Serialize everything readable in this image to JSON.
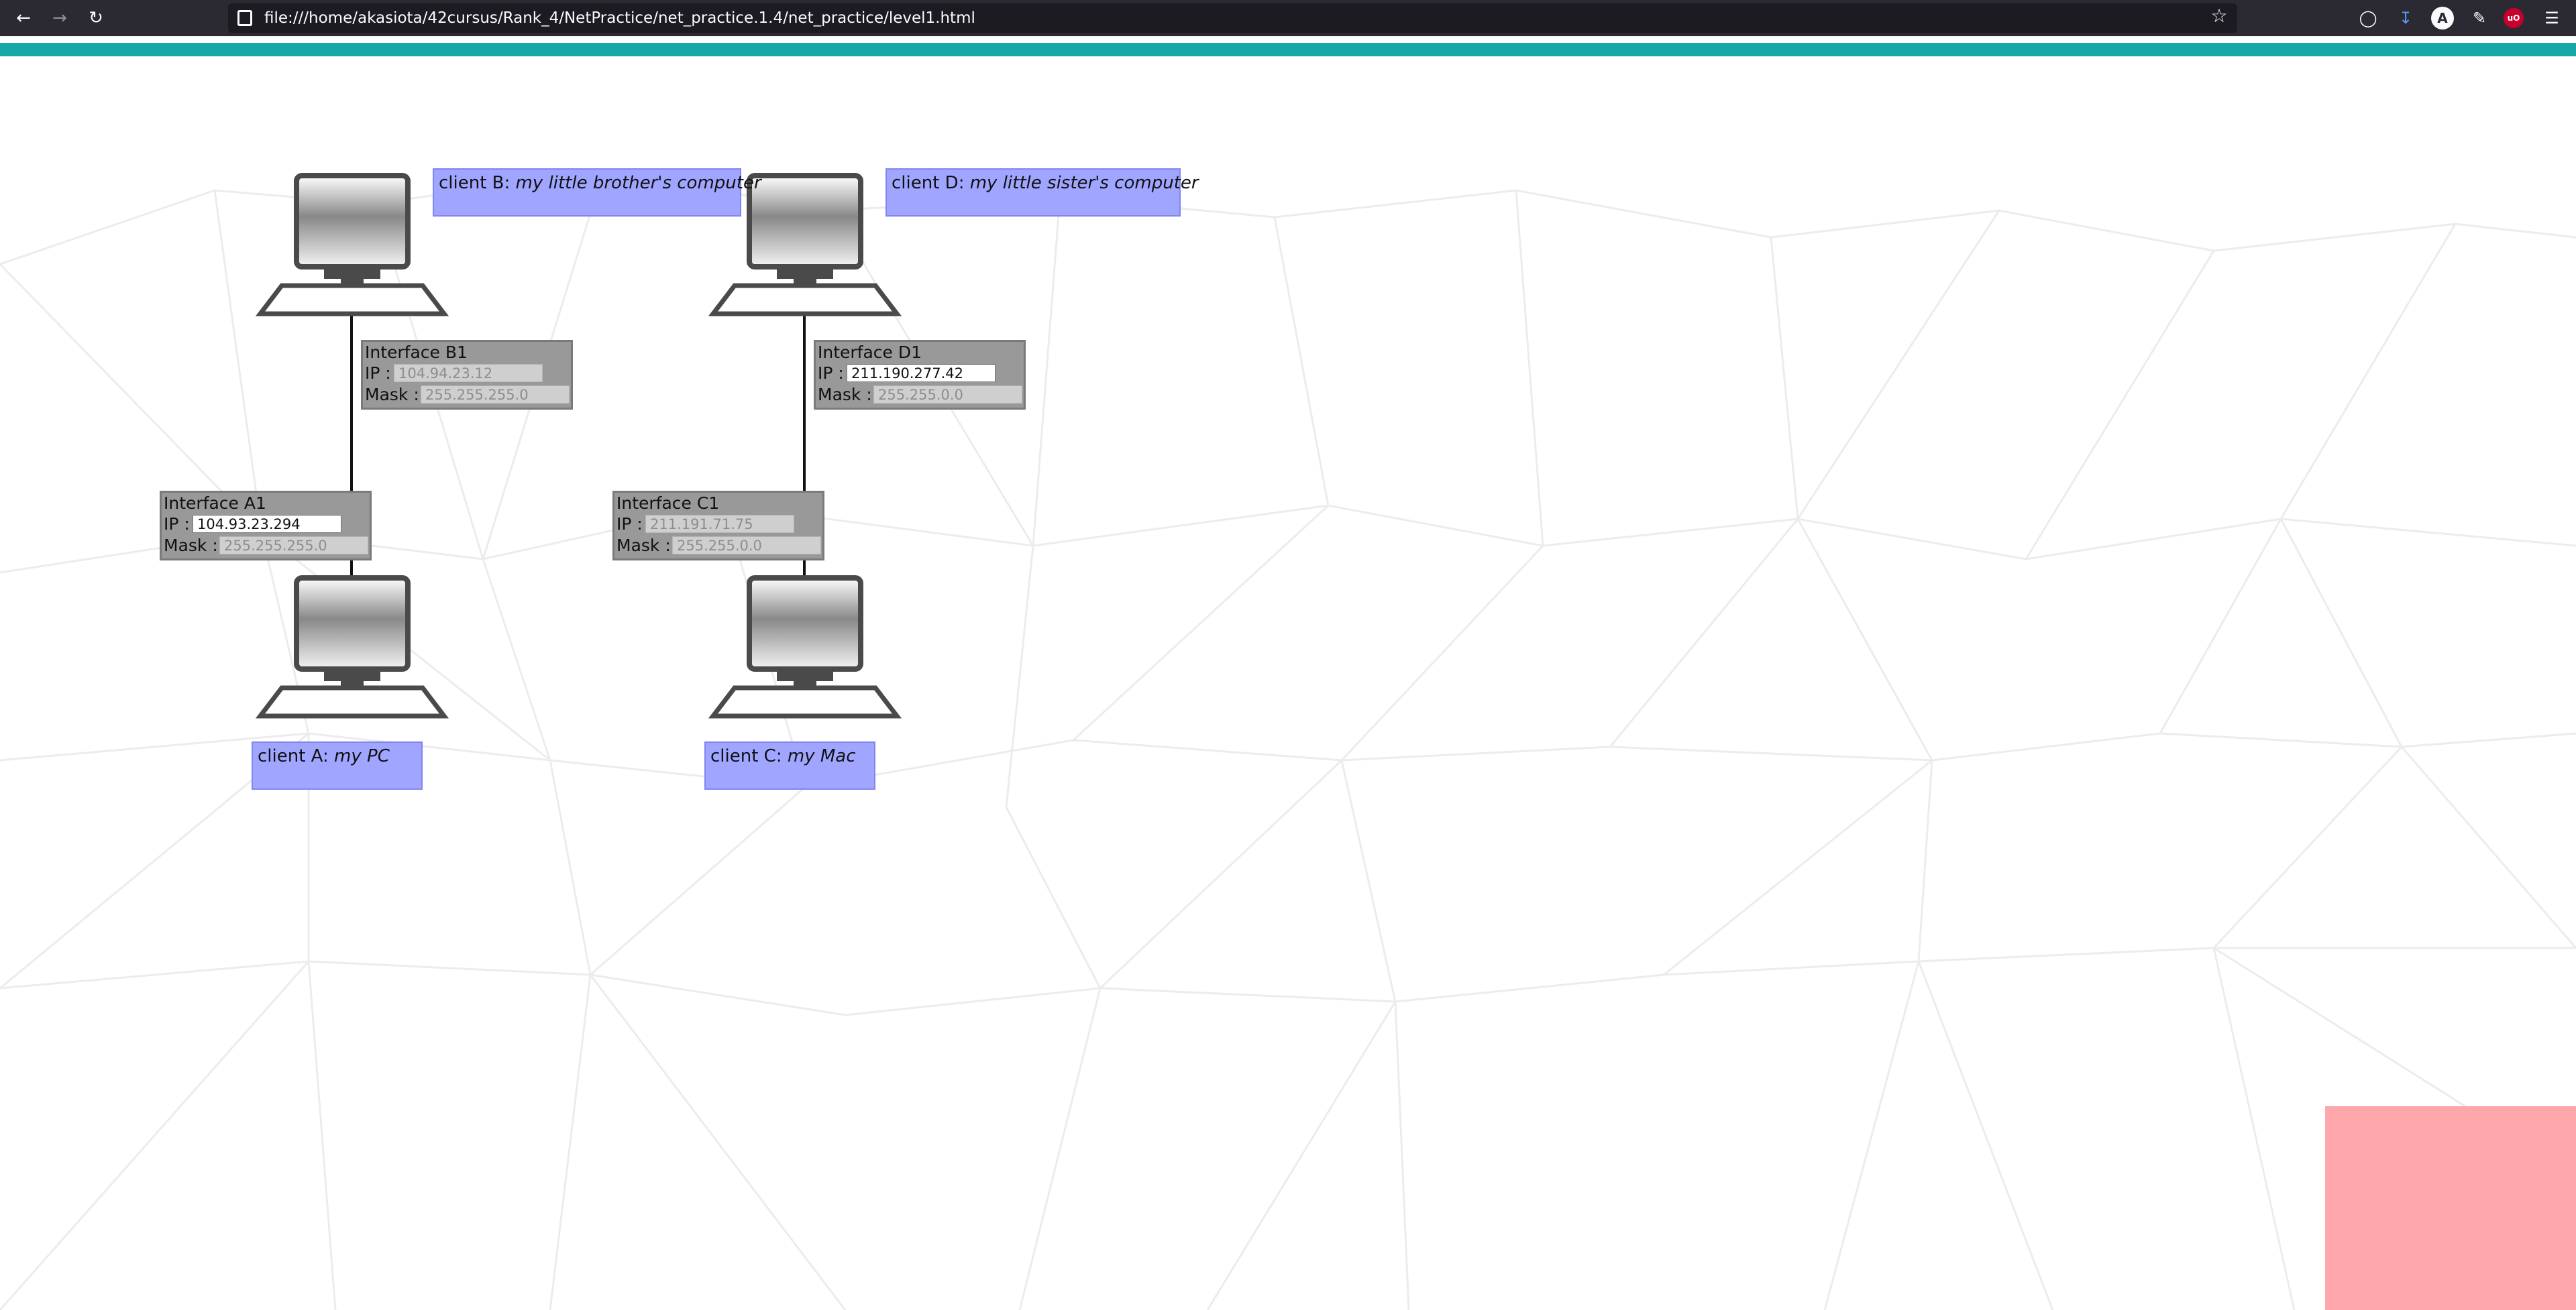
{
  "browser": {
    "url": "file:///home/akasiota/42cursus/Rank_4/NetPractice/net_practice.1.4/net_practice/level1.html",
    "back_icon": "arrow-left-icon",
    "forward_icon": "arrow-right-icon",
    "reload_icon": "reload-icon"
  },
  "clients": {
    "a": {
      "name": "client A:",
      "desc": "my PC"
    },
    "b": {
      "name": "client B:",
      "desc": "my little brother's computer"
    },
    "c": {
      "name": "client C:",
      "desc": "my Mac"
    },
    "d": {
      "name": "client D:",
      "desc": "my little sister's computer"
    }
  },
  "interfaces": {
    "a1": {
      "title": "Interface A1",
      "ip_label": "IP :",
      "ip": "104.93.23.294",
      "mask_label": "Mask :",
      "mask": "255.255.255.0"
    },
    "b1": {
      "title": "Interface B1",
      "ip_label": "IP :",
      "ip": "104.94.23.12",
      "mask_label": "Mask :",
      "mask": "255.255.255.0"
    },
    "c1": {
      "title": "Interface C1",
      "ip_label": "IP :",
      "ip": "211.191.71.75",
      "mask_label": "Mask :",
      "mask": "255.255.0.0"
    },
    "d1": {
      "title": "Interface D1",
      "ip_label": "IP :",
      "ip": "211.190.277.42",
      "mask_label": "Mask :",
      "mask": "255.255.0.0"
    }
  },
  "colors": {
    "teal_bar": "#16a7a9",
    "client_label": "#a0a6ff",
    "interface_box": "#999999",
    "result_box": "#ffa8ac"
  }
}
